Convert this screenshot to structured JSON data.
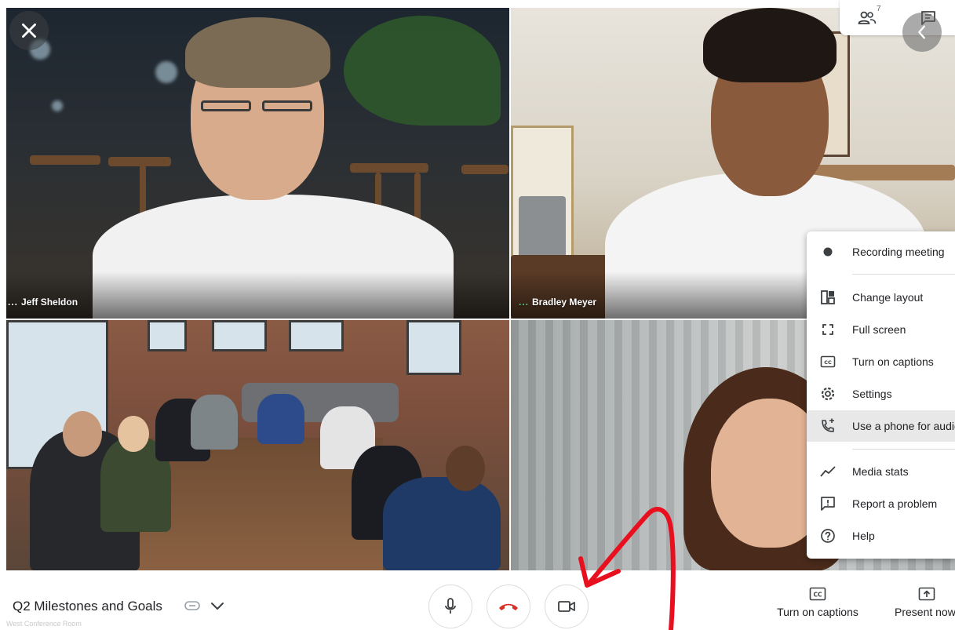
{
  "participants": [
    {
      "name": "Jeff Sheldon",
      "status_dots": "..."
    },
    {
      "name": "Bradley Meyer",
      "status_dots": "..."
    },
    {
      "name": "",
      "status_dots": ""
    },
    {
      "name": "",
      "status_dots": ""
    }
  ],
  "top_controls": {
    "people_count": "7",
    "close_icon": "close-icon",
    "people_icon": "people-icon",
    "chat_icon": "chat-icon",
    "back_icon": "chevron-left-icon"
  },
  "menu": {
    "items": [
      {
        "label": "Recording meeting",
        "icon": "record-dot-icon"
      },
      {
        "label": "Change layout",
        "icon": "layout-icon"
      },
      {
        "label": "Full screen",
        "icon": "fullscreen-icon"
      },
      {
        "label": "Turn on captions",
        "icon": "captions-icon"
      },
      {
        "label": "Settings",
        "icon": "gear-icon"
      },
      {
        "label": "Use a phone for audio",
        "icon": "phone-audio-icon",
        "active": true
      },
      {
        "label": "Media stats",
        "icon": "stats-icon"
      },
      {
        "label": "Report a problem",
        "icon": "report-icon"
      },
      {
        "label": "Help",
        "icon": "help-icon"
      }
    ]
  },
  "bottom_bar": {
    "meeting_title": "Q2 Milestones and Goals",
    "room_label": "West Conference Room",
    "captions_label": "Turn on captions",
    "present_label": "Present now"
  },
  "colors": {
    "end_call_red": "#d93025",
    "annotation_red": "#e8101f",
    "icon_gray": "#5f6368",
    "text_dark": "#202124"
  }
}
